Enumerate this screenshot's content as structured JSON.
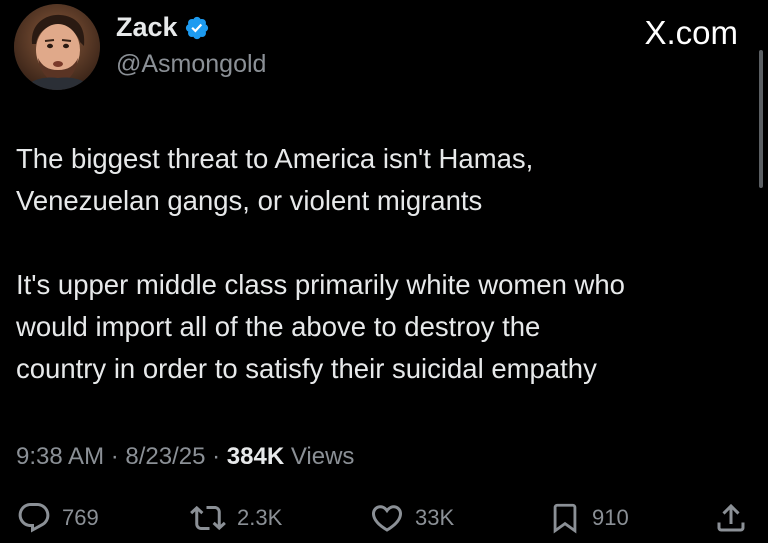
{
  "author": {
    "display_name": "Zack",
    "handle": "@Asmongold",
    "verified": true
  },
  "brand": "X.com",
  "tweet": {
    "paragraphs": [
      [
        "The biggest threat to America isn't Hamas,",
        "Venezuelan gangs, or violent migrants"
      ],
      [
        "It's upper middle class primarily white women who",
        "would import all of the above to destroy the",
        "country in order to satisfy their suicidal empathy"
      ]
    ]
  },
  "meta": {
    "time": "9:38 AM",
    "sep1": " · ",
    "date": "8/23/25",
    "sep2": " · ",
    "views_count": "384K",
    "views_label": " Views"
  },
  "actions": {
    "replies": "769",
    "reposts": "2.3K",
    "likes": "33K",
    "bookmarks": "910"
  },
  "icons": {
    "verified": "verified-badge-icon",
    "reply": "reply-icon",
    "repost": "repost-icon",
    "like": "heart-icon",
    "bookmark": "bookmark-icon",
    "share": "share-icon"
  },
  "colors": {
    "background": "#000000",
    "text": "#e7e9ea",
    "secondary": "#8b9096",
    "verified": "#1d9bf0"
  }
}
